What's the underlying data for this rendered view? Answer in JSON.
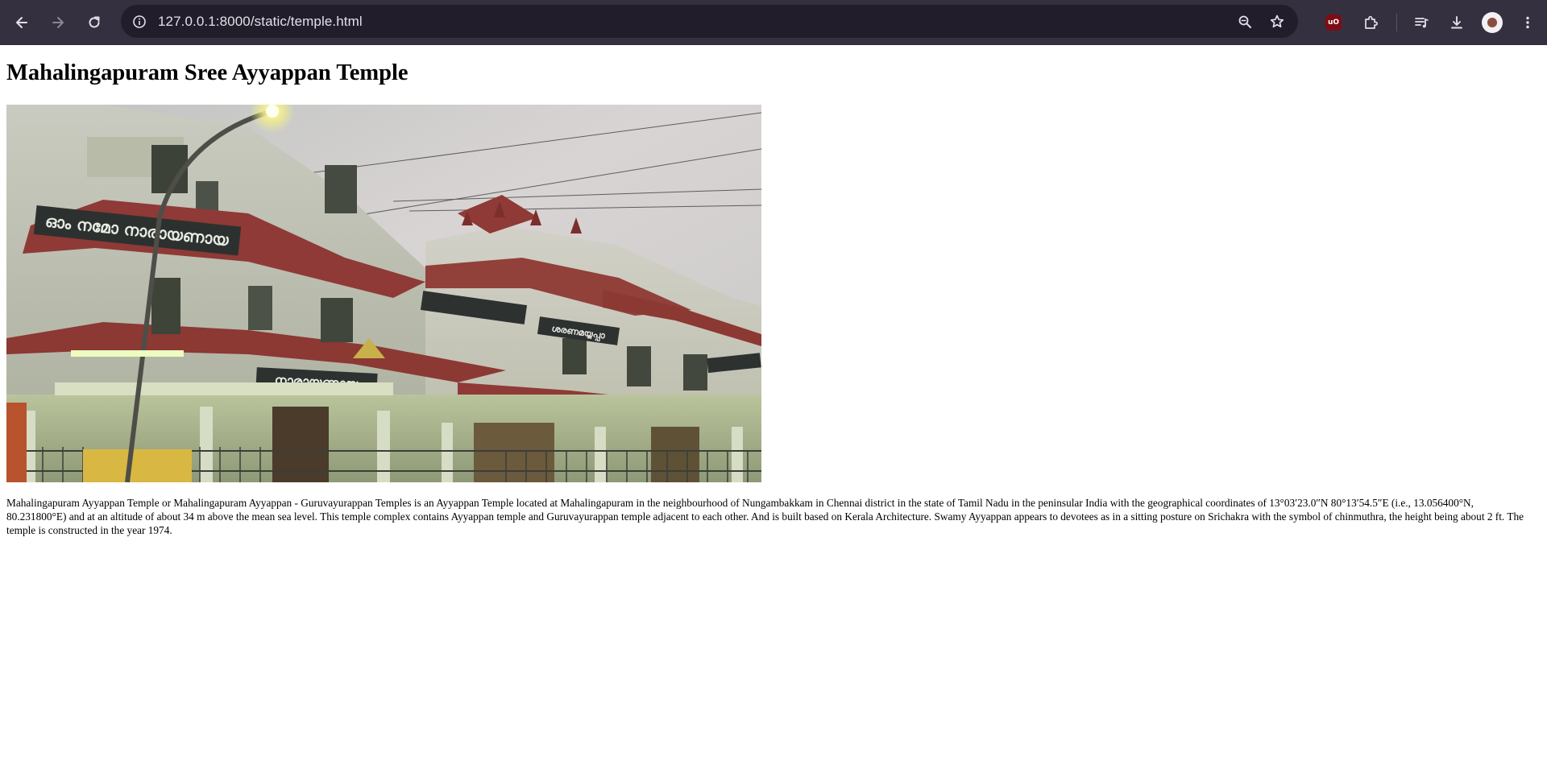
{
  "browser": {
    "url": "127.0.0.1:8000/static/temple.html",
    "icons": [
      "back-arrow-icon",
      "forward-arrow-icon",
      "reload-icon",
      "site-info-icon",
      "zoom-icon",
      "bookmark-star-icon",
      "ublock-origin-icon",
      "extensions-puzzle-icon",
      "reading-list-icon",
      "download-icon",
      "profile-avatar",
      "more-menu-icon"
    ],
    "ublock_badge": "uO"
  },
  "page": {
    "title": "Mahalingapuram Sree Ayyappan Temple",
    "image_signs": {
      "left_banner": "ഓം നമോ നാരായണായ",
      "gate_sign": "നാരായണായ",
      "right_sign": "ശരണമയ്യപ്പാ"
    },
    "description": "Mahalingapuram Ayyappan Temple or Mahalingapuram Ayyappan - Guruvayurappan Temples is an Ayyappan Temple located at Mahalingapuram in the neighbourhood of Nungambakkam in Chennai district in the state of Tamil Nadu in the peninsular India with the geographical coordinates of 13°03′23.0″N 80°13′54.5″E (i.e., 13.056400°N, 80.231800°E) and at an altitude of about 34 m above the mean sea level. This temple complex contains Ayyappan temple and Guruvayurappan temple adjacent to each other. And is built based on Kerala Architecture. Swamy Ayyappan appears to devotees as in a sitting posture on Srichakra with the symbol of chinmuthra, the height being about 2 ft. The temple is constructed in the year 1974."
  },
  "colors": {
    "toolbar_bg": "#35303f",
    "omnibox_bg": "#221d2b",
    "icon": "#e3e0e8",
    "ublock": "#7d0d14",
    "roof": "#8f3a36"
  }
}
